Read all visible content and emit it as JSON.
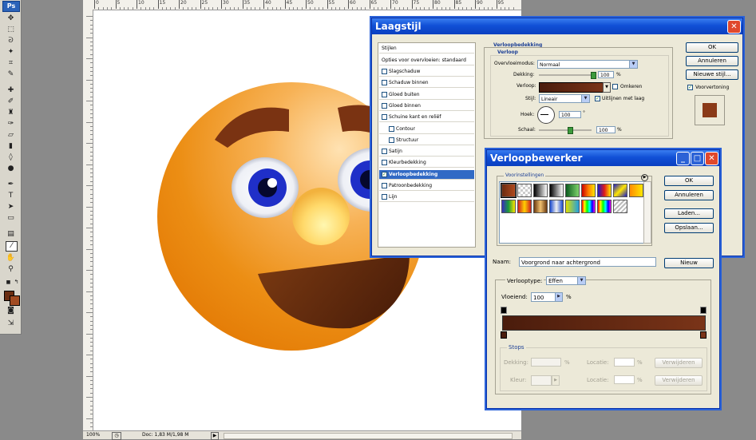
{
  "app": {
    "logo": "Ps",
    "tools": [
      "move-tool",
      "marquee-tool",
      "lasso-tool",
      "magic-wand-tool",
      "crop-tool",
      "slice-tool",
      "healing-brush-tool",
      "brush-tool",
      "clone-stamp-tool",
      "history-brush-tool",
      "eraser-tool",
      "gradient-tool",
      "blur-tool",
      "dodge-tool",
      "pen-tool",
      "type-tool",
      "path-selection-tool",
      "shape-tool",
      "notes-tool",
      "eyedropper-tool",
      "hand-tool",
      "zoom-tool",
      "default-colors",
      "swap-colors",
      "quick-mask-mode",
      "screen-mode",
      "jump-to-imageready"
    ]
  },
  "document": {
    "ruler_top": [
      "0",
      "5",
      "10",
      "15",
      "20",
      "25",
      "30",
      "35",
      "40",
      "45",
      "50",
      "55",
      "60",
      "65",
      "70",
      "75",
      "80",
      "85",
      "90",
      "95"
    ],
    "status": {
      "zoom": "100%",
      "doc_size": "Doc: 1,83 M/1,98 M"
    }
  },
  "layer_style": {
    "title": "Laagstijl",
    "styles_header": "Stijlen",
    "blend_options": "Opties voor overvloeien: standaard",
    "effects": [
      {
        "label": "Slagschaduw",
        "checked": false,
        "indent": false,
        "selected": false
      },
      {
        "label": "Schaduw binnen",
        "checked": false,
        "indent": false,
        "selected": false
      },
      {
        "label": "Gloed buiten",
        "checked": false,
        "indent": false,
        "selected": false
      },
      {
        "label": "Gloed binnen",
        "checked": false,
        "indent": false,
        "selected": false
      },
      {
        "label": "Schuine kant en reliëf",
        "checked": false,
        "indent": false,
        "selected": false
      },
      {
        "label": "Contour",
        "checked": false,
        "indent": true,
        "selected": false
      },
      {
        "label": "Structuur",
        "checked": false,
        "indent": true,
        "selected": false
      },
      {
        "label": "Satijn",
        "checked": false,
        "indent": false,
        "selected": false
      },
      {
        "label": "Kleurbedekking",
        "checked": false,
        "indent": false,
        "selected": false
      },
      {
        "label": "Verloopbedekking",
        "checked": true,
        "indent": false,
        "selected": true
      },
      {
        "label": "Patroonbedekking",
        "checked": false,
        "indent": false,
        "selected": false
      },
      {
        "label": "Lijn",
        "checked": false,
        "indent": false,
        "selected": false
      }
    ],
    "section_title": "Verloopbedekking",
    "group_title": "Verloop",
    "blend_mode_label": "Overvloeimodus:",
    "blend_mode_value": "Normaal",
    "opacity_label": "Dekking:",
    "opacity_value": "100",
    "gradient_label": "Verloop:",
    "reverse_label": "Omkeren",
    "style_label": "Stijl:",
    "style_value": "Lineair",
    "align_label": "Uitlijnen met laag",
    "angle_label": "Hoek:",
    "angle_value": "100",
    "scale_label": "Schaal:",
    "scale_value": "100",
    "percent": "%",
    "degree": "°",
    "ok": "OK",
    "cancel": "Annuleren",
    "new_style": "Nieuwe stijl...",
    "preview": "Voorvertoning",
    "colors": {
      "gradient_start": "#4a1c0c",
      "gradient_end": "#7a3418",
      "preview_swatch": "#8a3a18"
    }
  },
  "gradient_editor": {
    "title": "Verloopbewerker",
    "presets_label": "Voorinstellingen",
    "ok": "OK",
    "cancel": "Annuleren",
    "load": "Laden...",
    "save": "Opslaan...",
    "name_label": "Naam:",
    "name_value": "Voorgrond naar achtergrond",
    "new": "Nieuw",
    "type_label": "Verlooptype:",
    "type_value": "Effen",
    "smooth_label": "Vloeiend:",
    "smooth_value": "100",
    "percent": "%",
    "stops_label": "Stops",
    "opacity_label": "Dekking:",
    "location_label": "Locatie:",
    "color_label": "Kleur:",
    "delete": "Verwijderen",
    "presets": [
      "linear-gradient(90deg,#6b2b10,#b04a1e)",
      "repeating-conic-gradient(#ccc 0 25%,#fff 0 50%) 0 0/6px 6px",
      "linear-gradient(90deg,#000,#fff)",
      "linear-gradient(90deg,#000,#fff)",
      "linear-gradient(90deg,#0a5a1e,#7fd36b)",
      "linear-gradient(90deg,#c80000,#ff7b00,#ffe600)",
      "linear-gradient(90deg,#1a1ac8,#e01a1a,#ffe600)",
      "linear-gradient(135deg,#1a1ac8,#ffe600,#1a1ac8)",
      "linear-gradient(90deg,#ff8c00,#ffe600)",
      "linear-gradient(90deg,#3b2cc0,#1a9a3a,#ffe600)",
      "linear-gradient(90deg,#d02020,#ffd000,#d02020)",
      "linear-gradient(90deg,#6b3a10,#f0c070,#6b3a10)",
      "linear-gradient(90deg,#1a4ad0,#f0f0f0,#1a4ad0)",
      "linear-gradient(90deg,#e0e000,#20a0e0)",
      "linear-gradient(90deg,#ff0000,#ffff00,#00ff00,#00ffff,#0000ff,#ff00ff)",
      "linear-gradient(90deg,#ff0000,#ffff00,#00ff00,#00ffff,#0000ff,#ff00ff)",
      "repeating-linear-gradient(135deg,#bbb 0 2px,#fff 2px 4px)"
    ],
    "colors": {
      "bar_start": "#4a1c0c",
      "bar_end": "#7a3418"
    }
  }
}
